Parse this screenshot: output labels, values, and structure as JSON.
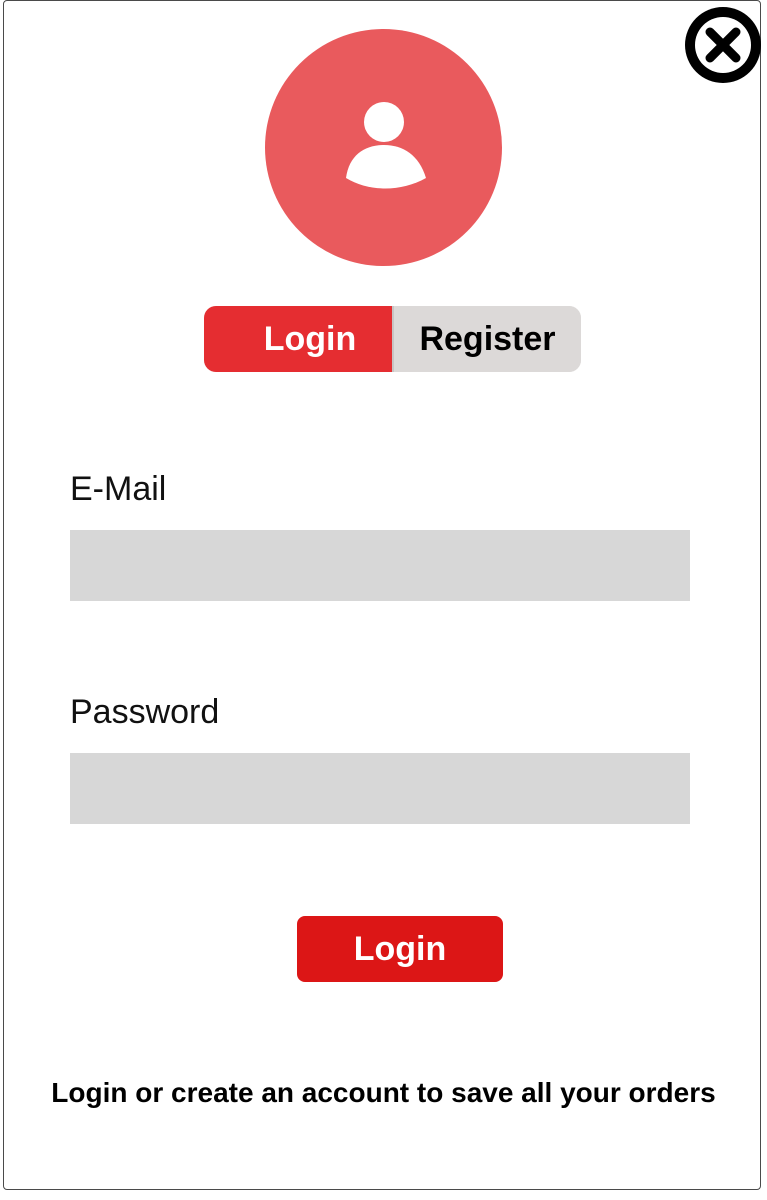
{
  "tabs": {
    "login_label": "Login",
    "register_label": "Register"
  },
  "form": {
    "email_label": "E-Mail",
    "email_value": "",
    "password_label": "Password",
    "password_value": ""
  },
  "submit": {
    "label": "Login"
  },
  "footer": {
    "note": "Login or create an account to save all your orders"
  },
  "icons": {
    "close": "close-circle-icon",
    "avatar": "user-icon"
  },
  "colors": {
    "avatar_bg": "#e95a5d",
    "tab_active": "#e52d31",
    "tab_inactive": "#dcd9d8",
    "submit_bg": "#dc1616",
    "input_bg": "#d7d7d7"
  }
}
